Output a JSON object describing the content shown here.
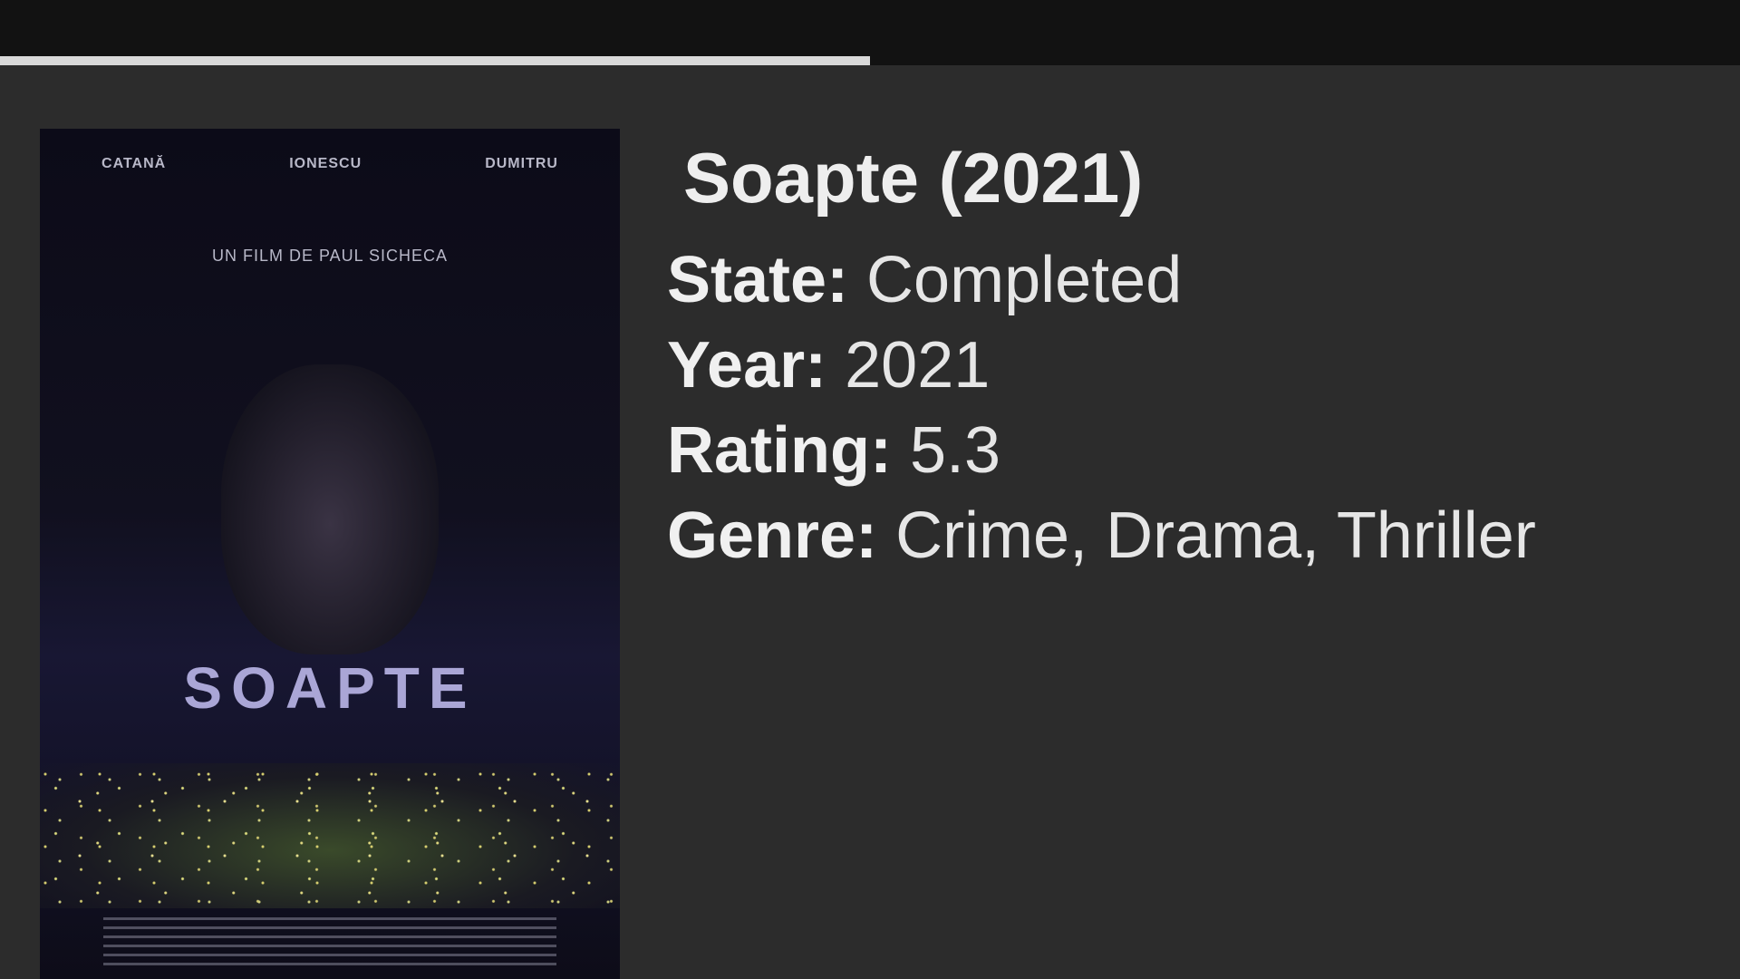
{
  "progress": {
    "fraction": 0.5
  },
  "poster": {
    "cast": [
      "CATANĂ",
      "IONESCU",
      "DUMITRU"
    ],
    "tagline": "UN FILM DE PAUL SICHECA",
    "title": "SOAPTE"
  },
  "movie": {
    "title": "Soapte (2021)",
    "state_label": "State:",
    "state_value": "Completed",
    "year_label": "Year:",
    "year_value": "2021",
    "rating_label": "Rating:",
    "rating_value": "5.3",
    "genre_label": "Genre:",
    "genre_value": "Crime, Drama, Thriller"
  },
  "colors": {
    "background": "#2c2c2c",
    "topbar": "#121212",
    "progress": "#d9d9d9",
    "text": "#e6e6e6"
  }
}
